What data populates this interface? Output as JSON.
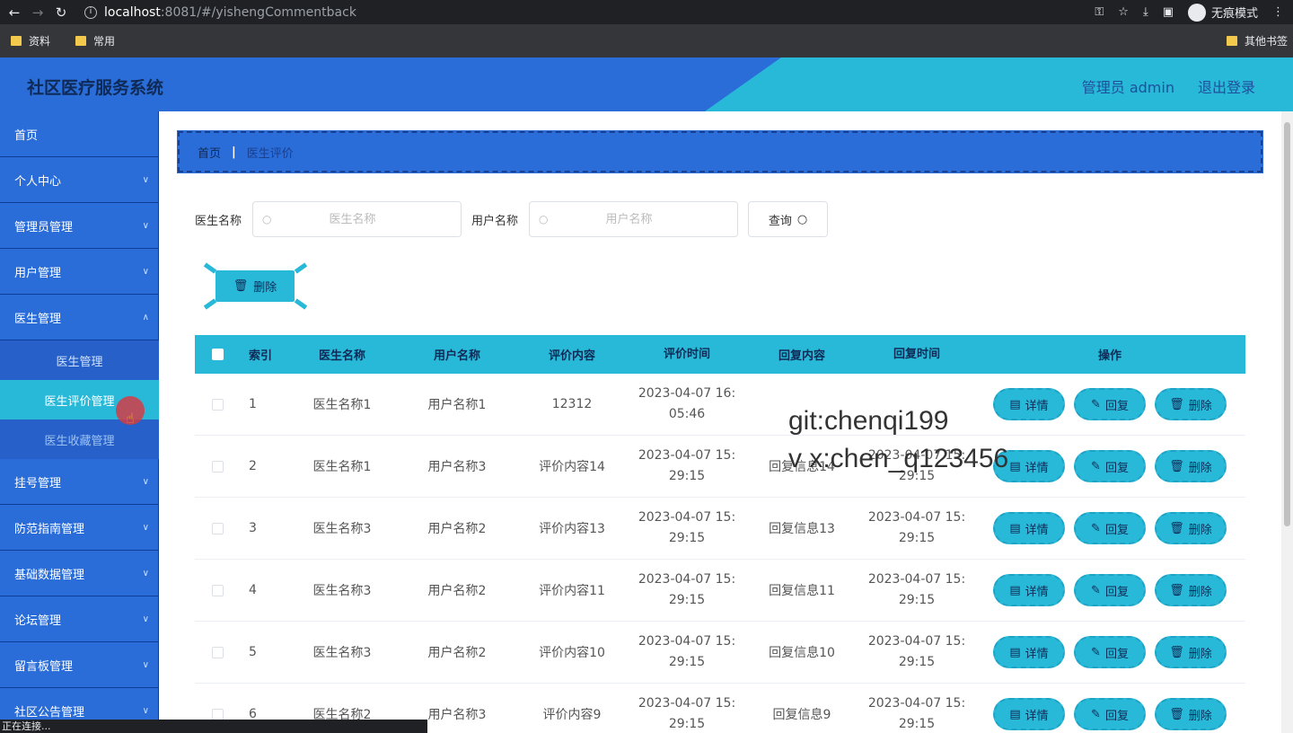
{
  "browser": {
    "url_host": "localhost",
    "url_path": ":8081/#/yishengCommentback",
    "incognito_label": "无痕模式",
    "bookmarks": [
      "资料",
      "常用"
    ],
    "other_bookmarks": "其他书签",
    "status": "正在连接..."
  },
  "header": {
    "title": "社区医疗服务系统",
    "user": "管理员 admin",
    "logout": "退出登录"
  },
  "sidebar": {
    "items": [
      {
        "label": "首页",
        "has_children": false
      },
      {
        "label": "个人中心",
        "has_children": true
      },
      {
        "label": "管理员管理",
        "has_children": true
      },
      {
        "label": "用户管理",
        "has_children": true
      },
      {
        "label": "医生管理",
        "has_children": true
      }
    ],
    "sub_items": [
      "医生管理",
      "医生评价管理",
      "医生收藏管理"
    ],
    "items_after": [
      {
        "label": "挂号管理"
      },
      {
        "label": "防范指南管理"
      },
      {
        "label": "基础数据管理"
      },
      {
        "label": "论坛管理"
      },
      {
        "label": "留言板管理"
      },
      {
        "label": "社区公告管理"
      }
    ]
  },
  "breadcrumb": {
    "home": "首页",
    "current": "医生评价"
  },
  "search": {
    "doctor_label": "医生名称",
    "doctor_placeholder": "医生名称",
    "user_label": "用户名称",
    "user_placeholder": "用户名称",
    "query_label": "查询"
  },
  "toolbar": {
    "delete_label": "删除"
  },
  "table": {
    "headers": [
      "索引",
      "医生名称",
      "用户名称",
      "评价内容",
      "评价时间",
      "回复内容",
      "回复时间",
      "操作"
    ],
    "ops": {
      "detail": "详情",
      "reply": "回复",
      "delete": "删除"
    },
    "rows": [
      {
        "idx": "1",
        "doctor": "医生名称1",
        "user": "用户名称1",
        "content": "12312",
        "time_a": "2023-04-07 16:",
        "time_b": "05:46",
        "reply": "",
        "rtime_a": "",
        "rtime_b": ""
      },
      {
        "idx": "2",
        "doctor": "医生名称1",
        "user": "用户名称3",
        "content": "评价内容14",
        "time_a": "2023-04-07 15:",
        "time_b": "29:15",
        "reply": "回复信息14",
        "rtime_a": "2023-04-07 15:",
        "rtime_b": "29:15"
      },
      {
        "idx": "3",
        "doctor": "医生名称3",
        "user": "用户名称2",
        "content": "评价内容13",
        "time_a": "2023-04-07 15:",
        "time_b": "29:15",
        "reply": "回复信息13",
        "rtime_a": "2023-04-07 15:",
        "rtime_b": "29:15"
      },
      {
        "idx": "4",
        "doctor": "医生名称3",
        "user": "用户名称2",
        "content": "评价内容11",
        "time_a": "2023-04-07 15:",
        "time_b": "29:15",
        "reply": "回复信息11",
        "rtime_a": "2023-04-07 15:",
        "rtime_b": "29:15"
      },
      {
        "idx": "5",
        "doctor": "医生名称3",
        "user": "用户名称2",
        "content": "评价内容10",
        "time_a": "2023-04-07 15:",
        "time_b": "29:15",
        "reply": "回复信息10",
        "rtime_a": "2023-04-07 15:",
        "rtime_b": "29:15"
      },
      {
        "idx": "6",
        "doctor": "医生名称2",
        "user": "用户名称3",
        "content": "评价内容9",
        "time_a": "2023-04-07 15:",
        "time_b": "29:15",
        "reply": "回复信息9",
        "rtime_a": "2023-04-07 15:",
        "rtime_b": "29:15"
      }
    ]
  },
  "watermark": {
    "line1": "git:chenqi199",
    "line2": "v x:chen_q123456"
  },
  "colors": {
    "primary": "#2a6dd8",
    "accent": "#29b9d8",
    "dark_text": "#0f2a56"
  }
}
